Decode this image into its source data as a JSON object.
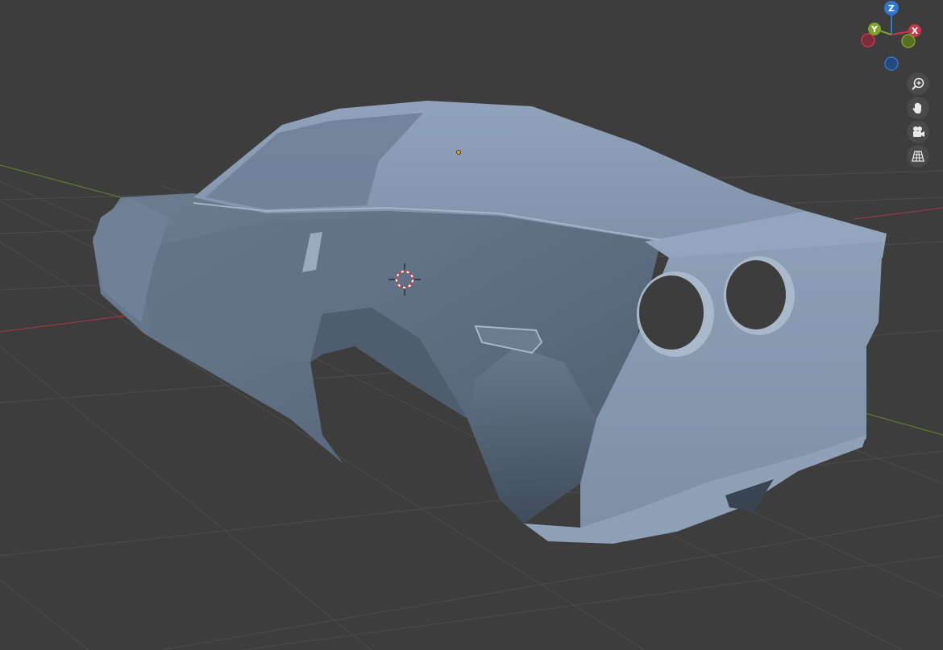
{
  "viewport": {
    "background": "#3d3d3d",
    "grid_color": "#4a4a4a",
    "x_axis_color": "#c8464f",
    "y_axis_color": "#7a9c30"
  },
  "model": {
    "body_color": "#8597ad",
    "shadow_color": "#4e5c6d",
    "highlight_color": "#a8b8cb"
  },
  "gizmo": {
    "x_label": "X",
    "y_label": "Y",
    "z_label": "Z",
    "x_color": "#c8384a",
    "y_color": "#7fa32a",
    "z_color": "#2f78cf"
  },
  "navigation": {
    "zoom": "zoom-icon",
    "pan": "hand-icon",
    "camera": "camera-icon",
    "perspective": "grid-icon"
  },
  "cursor_3d": "3d-cursor-icon",
  "origin_point": "origin-icon"
}
